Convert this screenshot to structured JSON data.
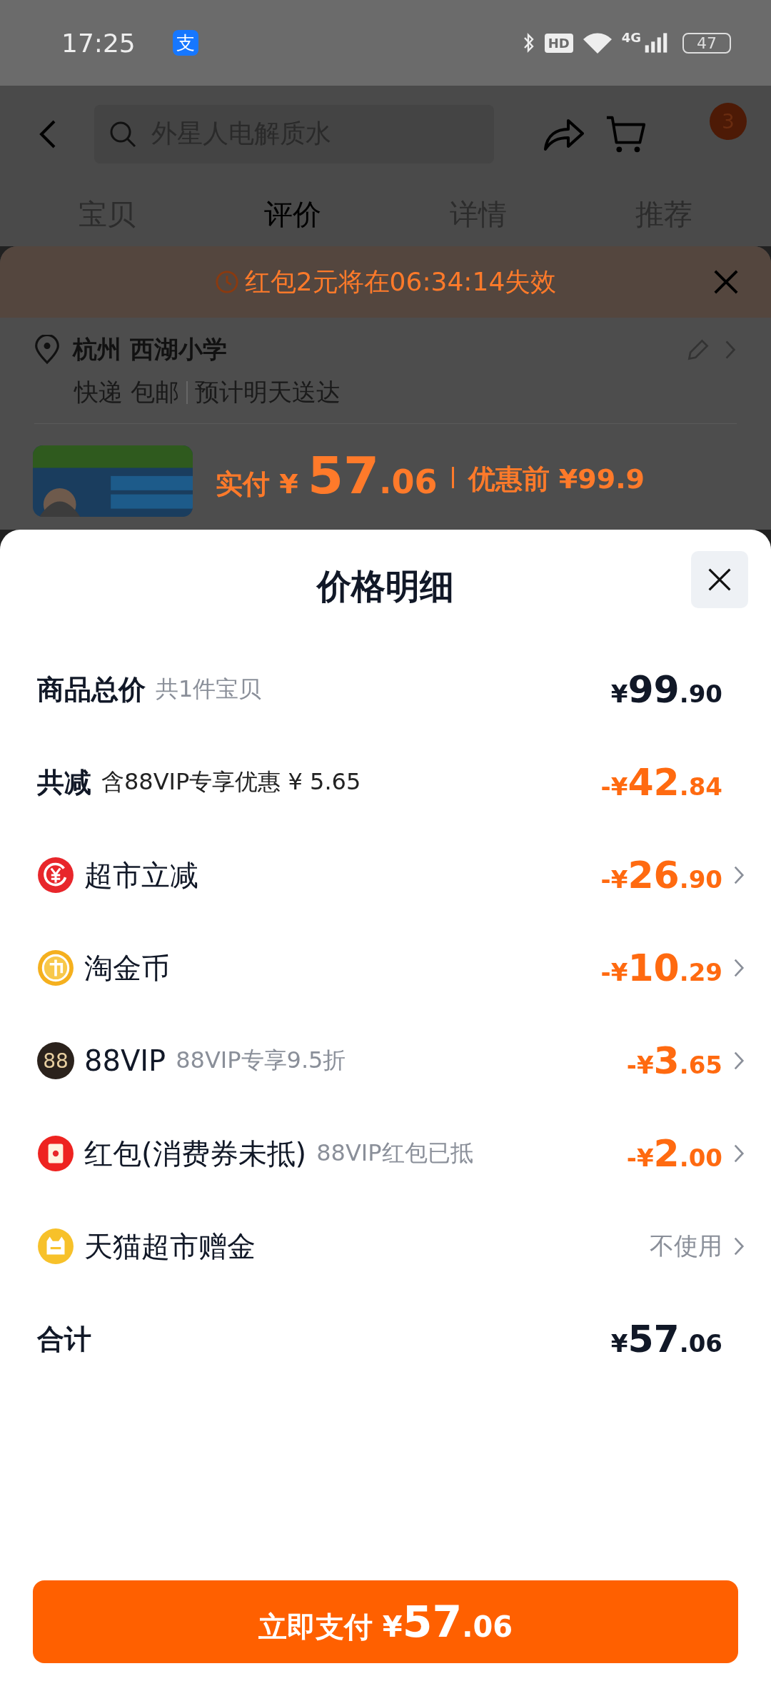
{
  "status_bar": {
    "time": "17:25",
    "notification_icon": "支",
    "hd": "HD",
    "network": "4G",
    "battery": "47"
  },
  "header": {
    "search_placeholder": "外星人电解质水",
    "cart_badge": "3"
  },
  "tabs": [
    {
      "label": "宝贝",
      "selected": false
    },
    {
      "label": "评价",
      "selected": true
    },
    {
      "label": "详情",
      "selected": false
    },
    {
      "label": "推荐",
      "selected": false
    }
  ],
  "order_panel": {
    "banner": "红包2元将在06:34:14失效",
    "address": {
      "title": "杭州 西湖小学",
      "delivery": "快递 包邮",
      "estimate": "预计明天送达"
    },
    "product": {
      "paid_label": "实付",
      "paid_currency": "¥",
      "paid_integer": "57",
      "paid_decimal": ".06",
      "original_label": "优惠前",
      "original_price": "¥99.9"
    }
  },
  "price_sheet": {
    "title": "价格明细",
    "rows": [
      {
        "kind": "subtotal",
        "label": "商品总价",
        "note": "共1件宝贝",
        "price": {
          "prefix": "¥",
          "integer": "99",
          "decimal": ".90"
        }
      },
      {
        "kind": "saving",
        "label": "共减",
        "note": "含88VIP专享优惠 ¥ 5.65",
        "price": {
          "prefix": "-¥",
          "integer": "42",
          "decimal": ".84"
        }
      },
      {
        "kind": "discount",
        "label": "超市立减",
        "price": {
          "prefix": "-¥",
          "integer": "26",
          "decimal": ".90"
        }
      },
      {
        "kind": "discount",
        "label": "淘金币",
        "price": {
          "prefix": "-¥",
          "integer": "10",
          "decimal": ".29"
        }
      },
      {
        "kind": "discount",
        "label": "88VIP",
        "icon_text": "88",
        "note": "88VIP专享9.5折",
        "price": {
          "prefix": "-¥",
          "integer": "3",
          "decimal": ".65"
        }
      },
      {
        "kind": "discount",
        "label": "红包(消费券未抵)",
        "note": "88VIP红包已抵",
        "price": {
          "prefix": "-¥",
          "integer": "2",
          "decimal": ".00"
        }
      },
      {
        "kind": "option",
        "label": "天猫超市赠金",
        "value": "不使用"
      },
      {
        "kind": "total",
        "label": "合计",
        "price": {
          "prefix": "¥",
          "integer": "57",
          "decimal": ".06"
        }
      }
    ],
    "pay_button": {
      "label": "立即支付",
      "currency": "¥",
      "integer": "57",
      "decimal": ".06"
    }
  }
}
